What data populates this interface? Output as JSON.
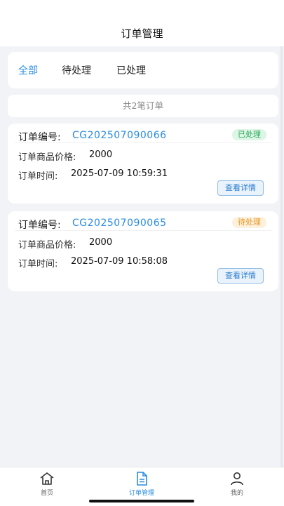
{
  "header": {
    "title": "订单管理"
  },
  "tabs": [
    {
      "label": "全部",
      "active": true
    },
    {
      "label": "待处理",
      "active": false
    },
    {
      "label": "已处理",
      "active": false
    }
  ],
  "summary": "共2笔订单",
  "orders": [
    {
      "no_label": "订单编号:",
      "no": "CG202507090066",
      "status": "已处理",
      "price_label": "订单商品价格:",
      "price": "2000",
      "time_label": "订单时间:",
      "time": "2025-07-09 10:59:31",
      "action": "查看详情"
    },
    {
      "no_label": "订单编号:",
      "no": "CG202507090065",
      "status": "待处理",
      "price_label": "订单商品价格:",
      "price": "2000",
      "time_label": "订单时间:",
      "time": "2025-07-09 10:58:08",
      "action": "查看详情"
    }
  ],
  "tabbar": [
    {
      "label": "首页",
      "icon": "home-icon"
    },
    {
      "label": "订单管理",
      "icon": "document-icon",
      "active": true
    },
    {
      "label": "我的",
      "icon": "user-icon"
    }
  ],
  "colors": {
    "accent": "#2a8ce0",
    "done": "#2aa85a",
    "pending": "#e69a2a"
  }
}
